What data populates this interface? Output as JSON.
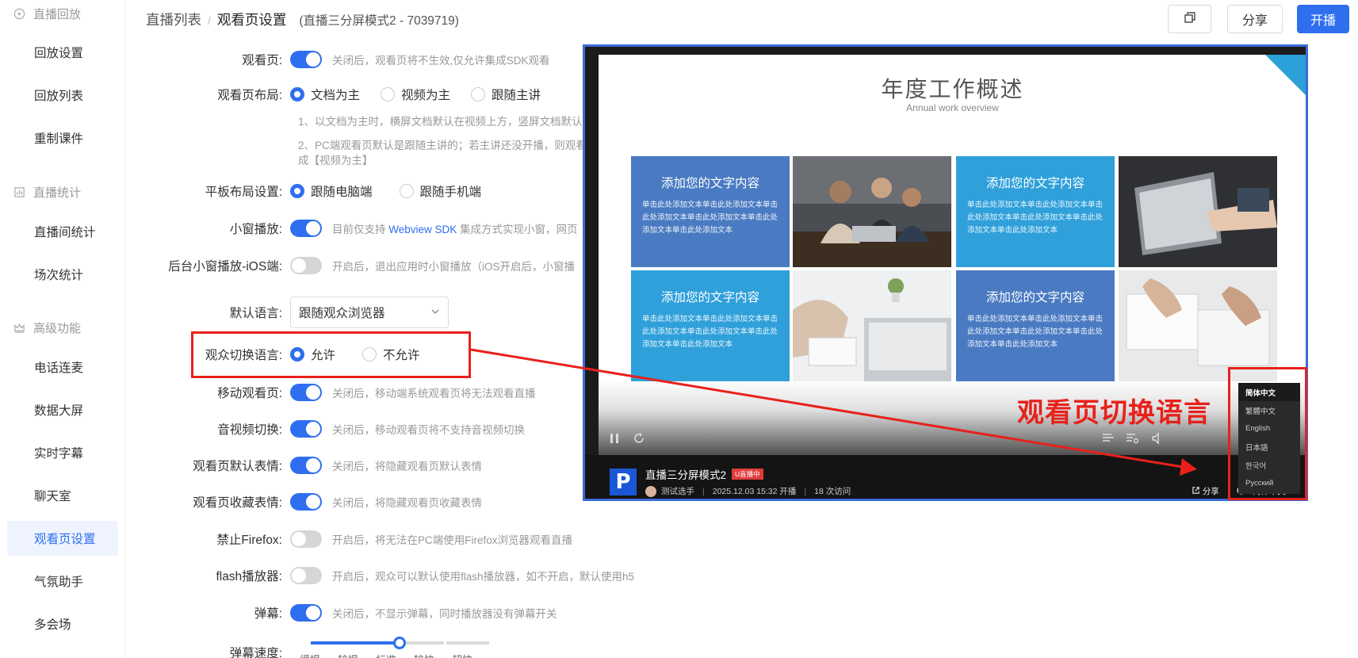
{
  "sidebar": {
    "groups": [
      {
        "label": "直播回放",
        "icon": "playback-icon"
      },
      {
        "label": "直播统计",
        "icon": "stats-icon"
      },
      {
        "label": "高级功能",
        "icon": "crown-icon"
      }
    ],
    "items": [
      {
        "label": "回放设置"
      },
      {
        "label": "回放列表"
      },
      {
        "label": "重制课件"
      },
      {
        "label": "直播间统计"
      },
      {
        "label": "场次统计"
      },
      {
        "label": "电话连麦"
      },
      {
        "label": "数据大屏"
      },
      {
        "label": "实时字幕"
      },
      {
        "label": "聊天室"
      },
      {
        "label": "观看页设置"
      },
      {
        "label": "气氛助手"
      },
      {
        "label": "多会场"
      }
    ]
  },
  "header": {
    "breadcrumb_root": "直播列表",
    "breadcrumb_sep": "/",
    "breadcrumb_current": "观看页设置",
    "breadcrumb_sub": "(直播三分屏模式2 - 7039719)",
    "share_label": "分享",
    "start_label": "开播"
  },
  "form": {
    "watch_page": {
      "label": "观看页:",
      "hint": "关闭后，观看页将不生效,仅允许集成SDK观看",
      "on": true
    },
    "layout": {
      "label": "观看页布局:",
      "options": [
        "文档为主",
        "视频为主",
        "跟随主讲"
      ],
      "selected": 0,
      "note1": "1、以文档为主时，横屏文档默认在视频上方，竖屏文档默认",
      "note2_line1": "2、PC端观看页默认是跟随主讲的；若主讲还没开播，则观看",
      "note2_line2": "成【视频为主】"
    },
    "tablet": {
      "label": "平板布局设置:",
      "options": [
        "跟随电脑端",
        "跟随手机端"
      ],
      "selected": 0
    },
    "mini_window": {
      "label": "小窗播放:",
      "hint_pre": "目前仅支持 ",
      "hint_link": "Webview SDK",
      "hint_post": " 集成方式实现小窗，网页",
      "on": true
    },
    "bg_mini_ios": {
      "label": "后台小窗播放-iOS端:",
      "hint": "开启后，退出应用时小窗播放（iOS开启后，小窗播",
      "on": false
    },
    "default_lang": {
      "label": "默认语言:",
      "value": "跟随观众浏览器"
    },
    "switch_lang": {
      "label": "观众切换语言:",
      "options": [
        "允许",
        "不允许"
      ],
      "selected": 0
    },
    "mobile_page": {
      "label": "移动观看页:",
      "hint": "关闭后，移动端系统观看页将无法观看直播",
      "on": true
    },
    "av_switch": {
      "label": "音视频切换:",
      "hint": "关闭后，移动观看页将不支持音视频切换",
      "on": true
    },
    "default_emoji": {
      "label": "观看页默认表情:",
      "hint": "关闭后，将隐藏观看页默认表情",
      "on": true
    },
    "fav_emoji": {
      "label": "观看页收藏表情:",
      "hint": "关闭后，将隐藏观看页收藏表情",
      "on": true
    },
    "firefox": {
      "label": "禁止Firefox:",
      "hint": "开启后，将无法在PC端使用Firefox浏览器观看直播",
      "on": false
    },
    "flash": {
      "label": "flash播放器:",
      "hint": "开启后，观众可以默认使用flash播放器，如不开启，默认使用h5",
      "on": false
    },
    "danmaku": {
      "label": "弹幕:",
      "hint": "关闭后，不显示弹幕，同时播放器没有弹幕开关",
      "on": true
    },
    "danmaku_speed": {
      "label": "弹幕速度:",
      "options": [
        "缓慢",
        "较慢",
        "标准",
        "较快",
        "超快"
      ],
      "level": 0.5
    }
  },
  "preview": {
    "slide_title": "年度工作概述",
    "slide_subtitle": "Annual work overview",
    "tile_heading": "添加您的文字内容",
    "tile_body": "单击此处添加文本单击此处添加文本单击此处添加文本单击此处添加文本单击此处添加文本单击此处添加文本",
    "room_title": "直播三分屏模式2",
    "live_badge": "U直播中",
    "host": "测试选手",
    "start_time": "2025.12.03 15:32 开播",
    "visits": "18 次访问",
    "share": "分享",
    "current_lang": "简体中文",
    "languages": [
      "简体中文",
      "繁體中文",
      "English",
      "日本語",
      "한국어",
      "Русский"
    ]
  },
  "annotation": {
    "text": "观看页切换语言",
    "color": "#e8211b"
  },
  "colors": {
    "primary": "#2f6fef",
    "tile_dark": "#4a7bc2",
    "tile_light": "#2fa0da"
  }
}
